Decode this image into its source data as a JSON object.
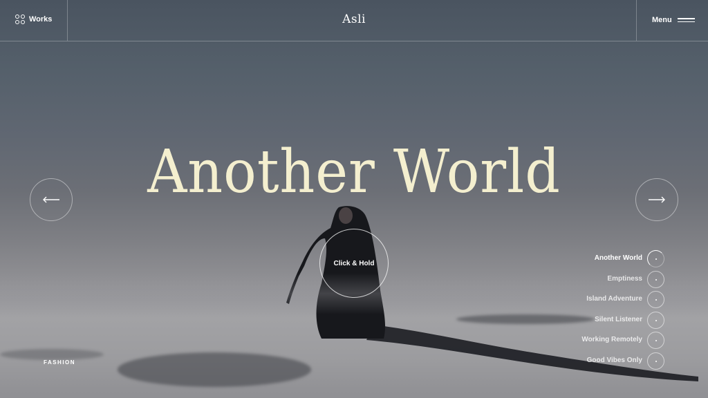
{
  "header": {
    "works_label": "Works",
    "logo": "Asli",
    "menu_label": "Menu"
  },
  "hero": {
    "title": "Another World",
    "hold_label": "Click & Hold",
    "category": "FASHION"
  },
  "slides": [
    {
      "label": "Another World",
      "active": true
    },
    {
      "label": "Emptiness",
      "active": false
    },
    {
      "label": "Island Adventure",
      "active": false
    },
    {
      "label": "Silent Listener",
      "active": false
    },
    {
      "label": "Working Remotely",
      "active": false
    },
    {
      "label": "Good Vibes Only",
      "active": false
    }
  ],
  "icons": {
    "works": "grid-circles-icon",
    "menu": "hamburger-icon",
    "prev": "arrow-left-icon",
    "next": "arrow-right-icon"
  },
  "colors": {
    "title": "#f4efcf",
    "text": "#ffffff"
  }
}
